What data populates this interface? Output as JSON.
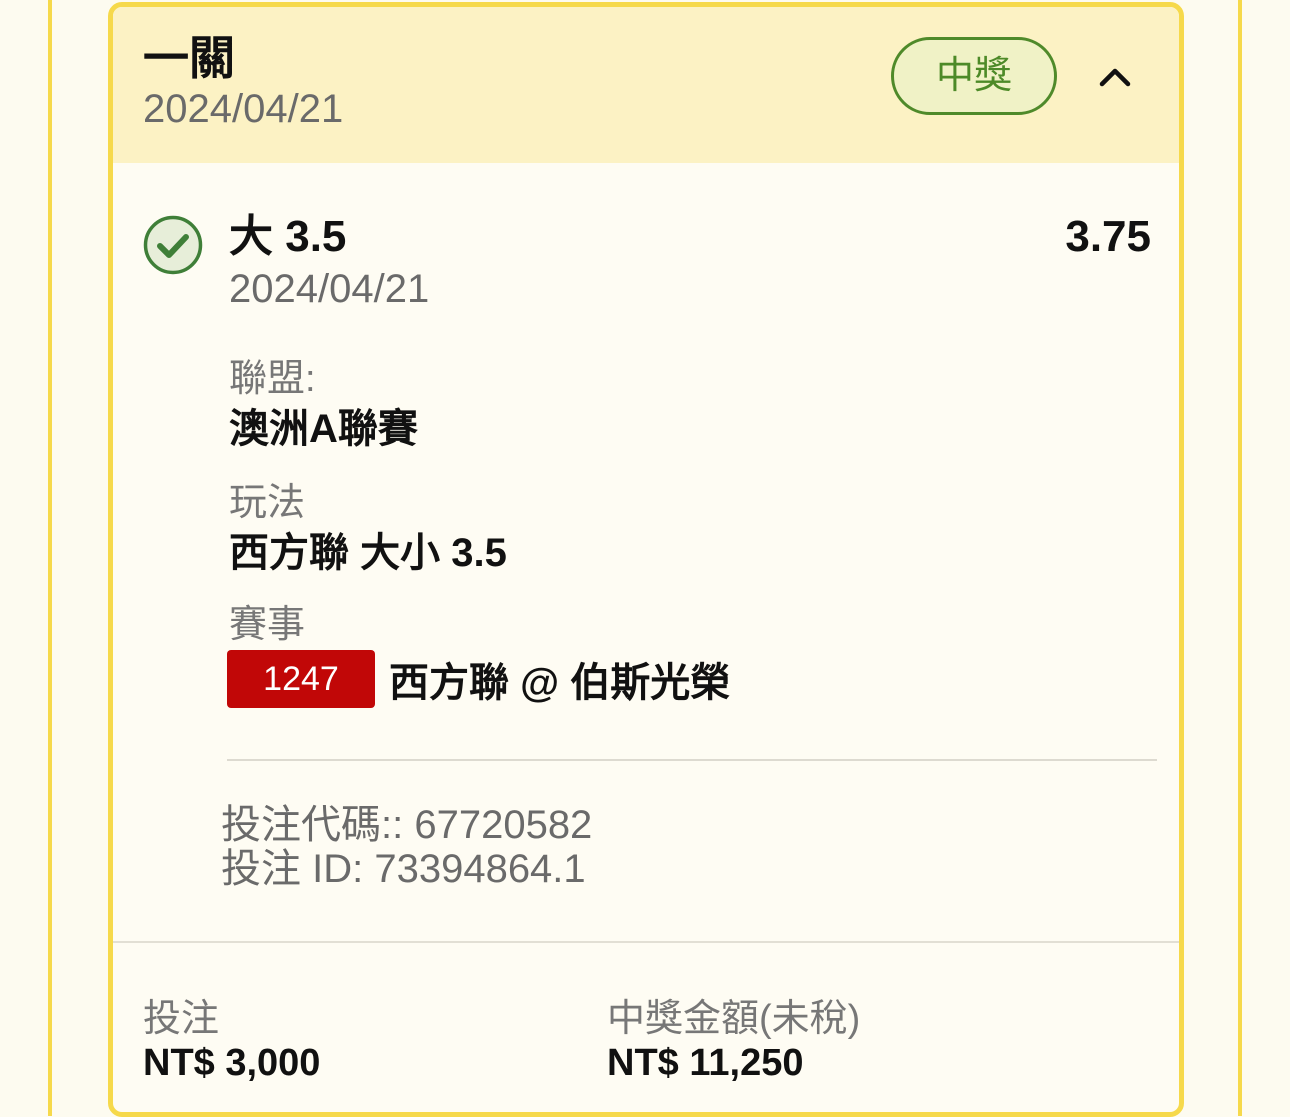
{
  "ticket": {
    "type_label": "一關",
    "date": "2024/04/21",
    "status": "中獎"
  },
  "selection": {
    "name": "大 3.5",
    "date": "2024/04/21",
    "odds": "3.75",
    "league_label": "聯盟:",
    "league": "澳洲A聯賽",
    "market_label": "玩法",
    "market": "西方聯 大小 3.5",
    "event_label": "賽事",
    "event_number": "1247",
    "event": "西方聯 @ 伯斯光榮"
  },
  "bet_info": {
    "bet_code": "投注代碼:: 67720582",
    "bet_id": "投注 ID: 73394864.1"
  },
  "footer": {
    "stake_label": "投注",
    "stake": "NT$ 3,000",
    "payout_label": "中獎金額(未稅)",
    "payout": "NT$ 11,250"
  },
  "colors": {
    "card_border": "#f6d94b",
    "header_bg": "#fcf2c4",
    "win_green": "#4d8a28",
    "event_badge_red": "#c10707"
  },
  "icons": {
    "collapse": "chevron-up-icon",
    "result": "check-circle-icon"
  }
}
